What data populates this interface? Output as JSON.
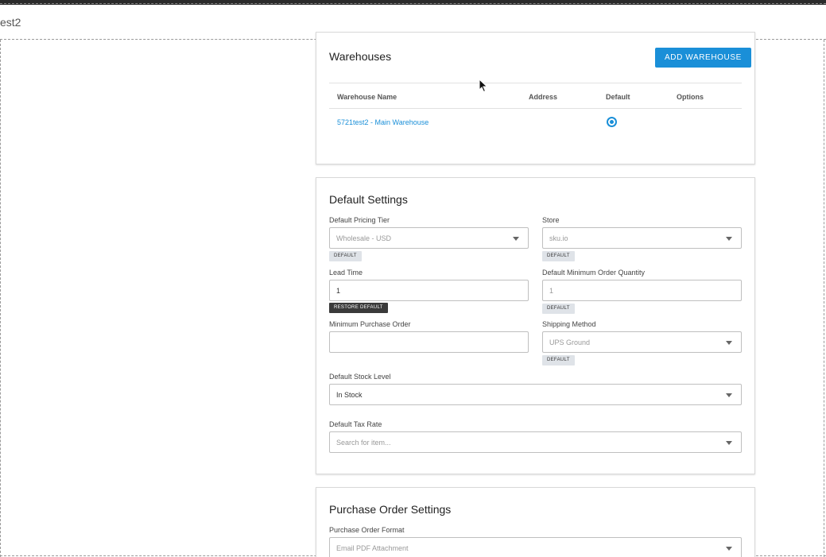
{
  "header": {
    "title": "est2"
  },
  "warehouses": {
    "title": "Warehouses",
    "add_button": "ADD WAREHOUSE",
    "columns": [
      "Warehouse Name",
      "Address",
      "Default",
      "Options"
    ],
    "rows": [
      {
        "name": "5721test2 - Main Warehouse",
        "address": "",
        "default": true,
        "options": ""
      }
    ]
  },
  "default_settings": {
    "title": "Default Settings",
    "pricing_tier": {
      "label": "Default Pricing Tier",
      "value": "Wholesale - USD",
      "tag": "DEFAULT"
    },
    "store": {
      "label": "Store",
      "value": "sku.io",
      "tag": "DEFAULT"
    },
    "lead_time": {
      "label": "Lead Time",
      "value": "1",
      "tag": "RESTORE DEFAULT"
    },
    "min_order_qty": {
      "label": "Default Minimum Order Quantity",
      "placeholder": "1",
      "tag": "DEFAULT"
    },
    "min_purchase_order": {
      "label": "Minimum Purchase Order",
      "value": ""
    },
    "shipping_method": {
      "label": "Shipping Method",
      "value": "UPS Ground",
      "tag": "DEFAULT"
    },
    "stock_level": {
      "label": "Default Stock Level",
      "value": "In Stock"
    },
    "tax_rate": {
      "label": "Default Tax Rate",
      "placeholder": "Search for item..."
    }
  },
  "purchase_order_settings": {
    "title": "Purchase Order Settings",
    "format": {
      "label": "Purchase Order Format",
      "value": "Email PDF Attachment"
    }
  },
  "colors": {
    "accent": "#1a8fd8",
    "tag_bg": "#dfe3e8",
    "tag_dark_bg": "#3a3a3a"
  },
  "icons": {
    "caret": "chevron-down-icon",
    "radio": "radio-checked-icon",
    "cursor": "mouse-pointer-icon"
  }
}
